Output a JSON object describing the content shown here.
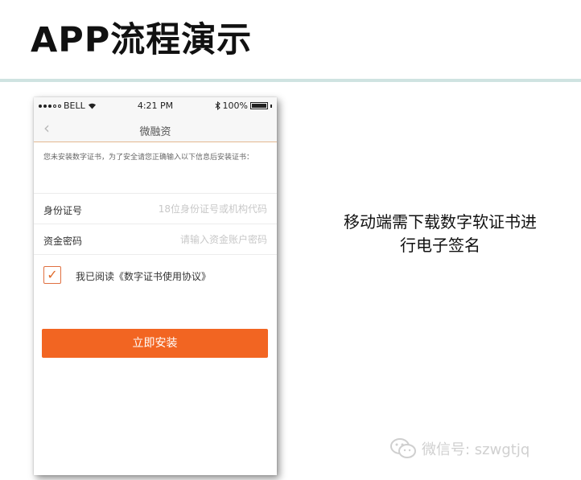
{
  "slide": {
    "title": "APP流程演示",
    "caption_line1": "移动端需下载数字软证书进",
    "caption_line2": "行电子签名",
    "watermark_text": "微信号: szwgtjq"
  },
  "phone": {
    "status_bar": {
      "carrier": "BELL",
      "time": "4:21 PM",
      "battery": "100%"
    },
    "nav": {
      "title": "微融资",
      "back_icon": "chevron-left-icon"
    },
    "notice": "您未安装数字证书，为了安全请您正确输入以下信息后安装证书：",
    "fields": [
      {
        "label": "身份证号",
        "placeholder": "18位身份证号或机构代码",
        "value": ""
      },
      {
        "label": "资金密码",
        "placeholder": "请输入资金账户密码",
        "value": ""
      }
    ],
    "agreement": {
      "checked": true,
      "text": "我已阅读《数字证书使用协议》"
    },
    "install_button": "立即安装"
  },
  "colors": {
    "accent": "#f26522",
    "divider": "#cfe3e1",
    "watermark": "#d0d0d0"
  }
}
